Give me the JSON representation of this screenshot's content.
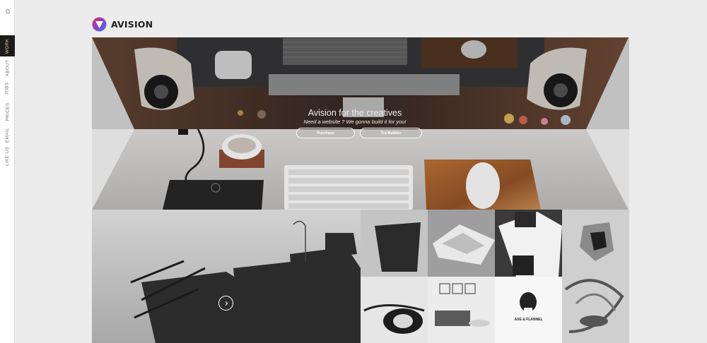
{
  "sidebar": {
    "home_icon": "home-icon",
    "items": [
      {
        "label": "WORK",
        "active": true
      },
      {
        "label": "ABOUT",
        "active": false
      },
      {
        "label": "JOBS",
        "active": false
      },
      {
        "label": "PRICES",
        "active": false
      },
      {
        "label": "EMAIL",
        "active": false
      },
      {
        "label": "LIKE US",
        "active": false
      }
    ]
  },
  "header": {
    "logo_icon": "avision-logo-icon",
    "brand": "AVISION"
  },
  "hero": {
    "title": "Avision for the creatives",
    "subtitle": "Need a website ? We gonna build it for you!",
    "purchase_label": "Purchase",
    "try_builder_label": "Try Builder"
  },
  "gallery": {
    "play_icon": "chevron-right-icon",
    "tile_4_logo_text": "AXE & FLANNEL"
  },
  "colors": {
    "accent": "#e4c98c",
    "sidebar_active_bg": "#1b1b1b",
    "page_bg": "#ececec"
  }
}
